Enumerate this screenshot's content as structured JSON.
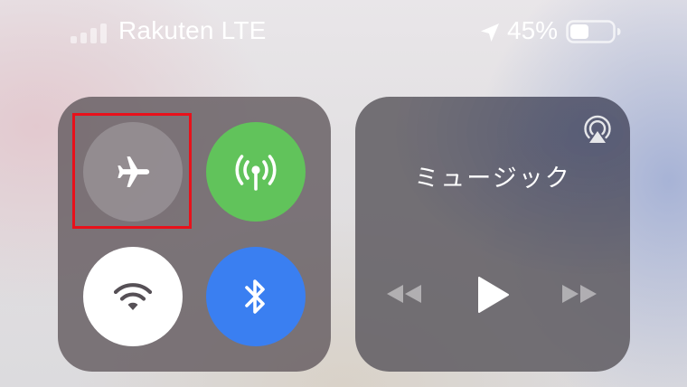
{
  "status_bar": {
    "carrier": "Rakuten LTE",
    "signal_bars_active": 0,
    "signal_bars_total": 4,
    "location_icon": "location-arrow-icon",
    "battery_percent_label": "45%",
    "battery_level": 0.45
  },
  "connectivity": {
    "toggles": [
      {
        "id": "airplane",
        "icon": "airplane-icon",
        "state": "off",
        "color": "#968f93"
      },
      {
        "id": "cellular",
        "icon": "antenna-icon",
        "state": "on",
        "color": "#61c35b"
      },
      {
        "id": "wifi",
        "icon": "wifi-icon",
        "state": "on",
        "color": "#ffffff"
      },
      {
        "id": "bluetooth",
        "icon": "bluetooth-icon",
        "state": "on",
        "color": "#3a7ff1"
      }
    ],
    "highlight_color": "#e8111b"
  },
  "music": {
    "title": "ミュージック",
    "airplay_icon": "airplay-icon",
    "controls": [
      "rewind-icon",
      "play-icon",
      "fast-forward-icon"
    ]
  }
}
